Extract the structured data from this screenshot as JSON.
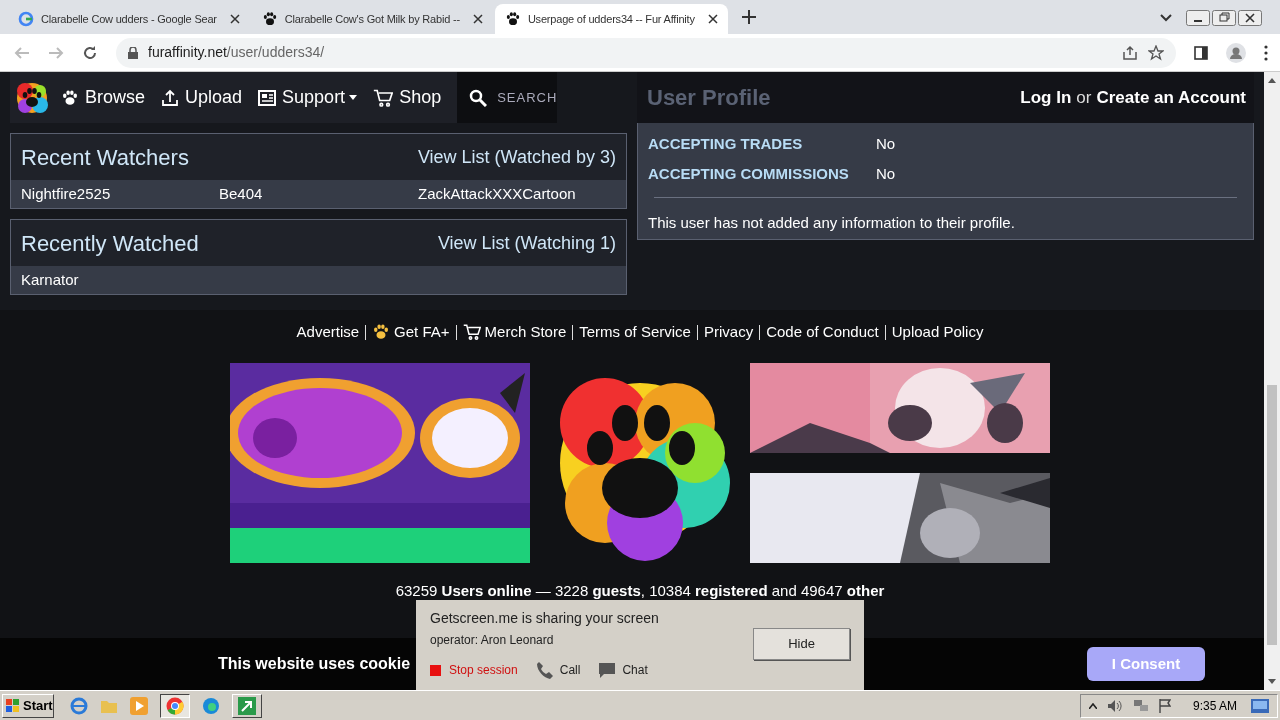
{
  "browser": {
    "tabs": [
      {
        "title": "Clarabelle Cow udders - Google Sear",
        "selected": false
      },
      {
        "title": "Clarabelle Cow's Got Milk by Rabid --",
        "selected": false
      },
      {
        "title": "Userpage of udders34 -- Fur Affinity",
        "selected": true
      }
    ],
    "url_host": "furaffinity.net",
    "url_path": "/user/udders34/"
  },
  "nav": {
    "items": [
      {
        "label": "Browse"
      },
      {
        "label": "Upload"
      },
      {
        "label": "Support"
      },
      {
        "label": "Shop"
      }
    ],
    "search": "SEARCH"
  },
  "profile": {
    "title": "User Profile",
    "login": "Log In",
    "or": "or",
    "create": "Create an Account",
    "fields": [
      {
        "label": "ACCEPTING TRADES",
        "value": "No"
      },
      {
        "label": "ACCEPTING COMMISSIONS",
        "value": "No"
      }
    ],
    "note": "This user has not added any information to their profile."
  },
  "watch_boxes": [
    {
      "title": "Recent Watchers",
      "link": "View List (Watched by 3)",
      "users": [
        "Nightfire2525",
        "Be404",
        "ZackAttackXXXCartoon"
      ]
    },
    {
      "title": "Recently Watched",
      "link": "View List (Watching 1)",
      "users": [
        "Karnator"
      ]
    }
  ],
  "footer": {
    "links": [
      {
        "label": "Advertise"
      },
      {
        "label": "Get FA+"
      },
      {
        "label": "Merch Store"
      },
      {
        "label": "Terms of Service"
      },
      {
        "label": "Privacy"
      },
      {
        "label": "Code of Conduct"
      },
      {
        "label": "Upload Policy"
      }
    ],
    "stats": "63259 **Users online** — 3228 **guests**, 10384 **registered** and 49647 **other**"
  },
  "cookie_bar": {
    "text": "This website uses cookie",
    "button": "I Consent"
  },
  "share_popup": {
    "title": "Getscreen.me is sharing your screen",
    "operator": "operator: Aron Leonard",
    "hide": "Hide",
    "stop": "Stop session",
    "call": "Call",
    "chat": "Chat"
  },
  "taskbar": {
    "start": "Start",
    "time": "9:35 AM"
  }
}
